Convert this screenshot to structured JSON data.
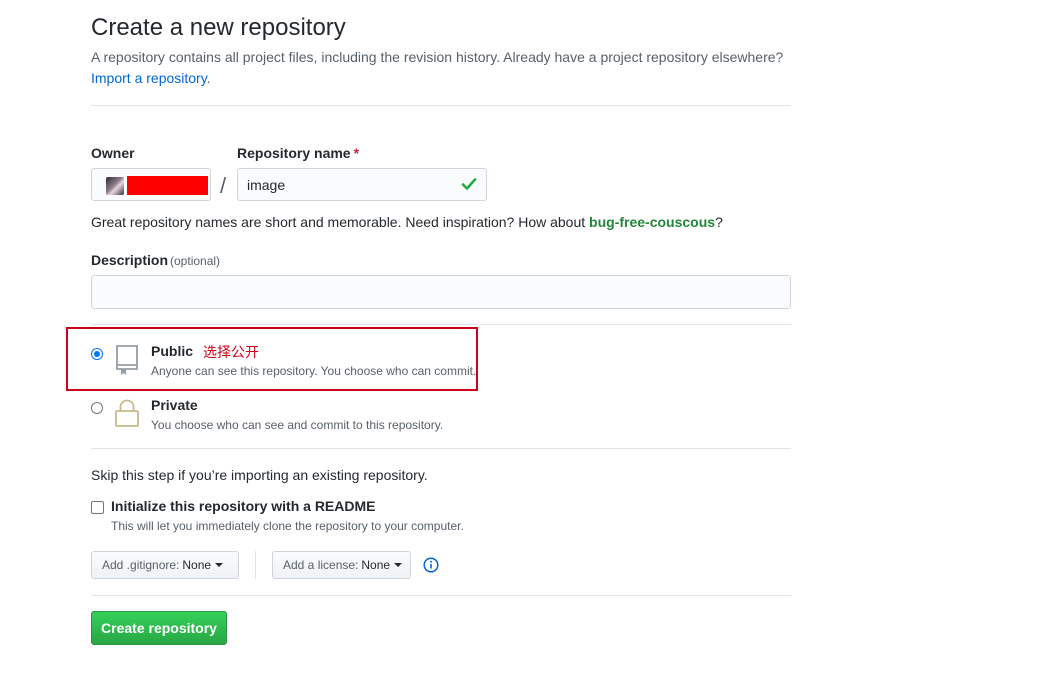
{
  "header": {
    "title": "Create a new repository",
    "subtitle": "A repository contains all project files, including the revision history. Already have a project repository elsewhere?",
    "import_link": "Import a repository",
    "import_suffix": "."
  },
  "form": {
    "owner_label": "Owner",
    "repo_name_label": "Repository name",
    "required_mark": "*",
    "slash": "/",
    "repo_name_value": "image",
    "hint_prefix": "Great repository names are short and memorable. Need inspiration? How about ",
    "hint_suggestion": "bug-free-couscous",
    "hint_suffix": "?",
    "description_label": "Description",
    "description_optional": "(optional)",
    "description_value": ""
  },
  "visibility": {
    "public": {
      "title": "Public",
      "annotation": "选择公开",
      "desc": "Anyone can see this repository. You choose who can commit.",
      "icon": "repo-icon",
      "checked": true
    },
    "private": {
      "title": "Private",
      "desc": "You choose who can see and commit to this repository.",
      "icon": "lock-icon",
      "checked": false
    }
  },
  "init": {
    "skip_text": "Skip this step if you’re importing an existing repository.",
    "readme_label": "Initialize this repository with a README",
    "readme_desc": "This will let you immediately clone the repository to your computer.",
    "gitignore_label": "Add .gitignore:",
    "gitignore_value": "None",
    "license_label": "Add a license:",
    "license_value": "None"
  },
  "actions": {
    "create_label": "Create repository"
  },
  "colors": {
    "link": "#0366d6",
    "suggestion": "#22863a",
    "annotation_red": "#d0021b",
    "primary_button": "#28a745"
  }
}
